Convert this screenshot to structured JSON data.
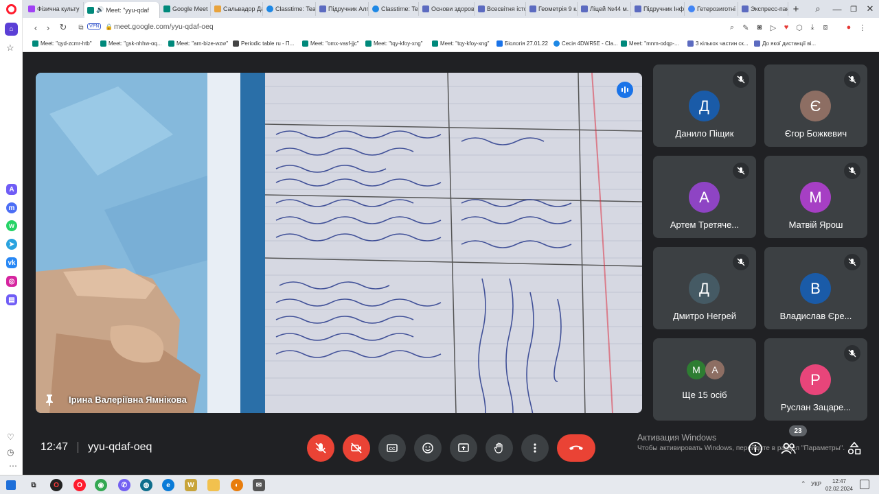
{
  "browser": {
    "tabs": [
      {
        "label": "Фізична культу",
        "color": "#a142f4"
      },
      {
        "label": "Meet: \"yyu-qdaf",
        "color": "#00897b",
        "active": true
      },
      {
        "label": "Google Meet",
        "color": "#00897b"
      },
      {
        "label": "Сальвадор Да",
        "color": "#e8a33d"
      },
      {
        "label": "Classtime: Teac",
        "color": "#1e88e5"
      },
      {
        "label": "Підручник Алг",
        "color": "#5c6bc0"
      },
      {
        "label": "Classtime: Teac",
        "color": "#1e88e5"
      },
      {
        "label": "Основи здоров",
        "color": "#5c6bc0"
      },
      {
        "label": "Всесвітня істор",
        "color": "#5c6bc0"
      },
      {
        "label": "Геометрія 9 кл",
        "color": "#5c6bc0"
      },
      {
        "label": "Ліцей №44 м.",
        "color": "#5c6bc0"
      },
      {
        "label": "Підручник Інф",
        "color": "#5c6bc0"
      },
      {
        "label": "Гетерозиготні",
        "color": "#4285f4"
      },
      {
        "label": "Экспресс-пане",
        "color": "#5c6bc0"
      }
    ],
    "url": "meet.google.com/yyu-qdaf-oeq",
    "vpn_label": "VPN",
    "bookmarks": [
      {
        "label": "Meet: \"qyd-zcmr-htb\"",
        "color": "#00897b"
      },
      {
        "label": "Meet: \"gsk-nhhw-oq...",
        "color": "#00897b"
      },
      {
        "label": "Meet: \"arn-bize-wzw\"",
        "color": "#00897b"
      },
      {
        "label": "Periodic table ru - П...",
        "color": "#444444"
      },
      {
        "label": "Meet: \"omx-vasf-jjc\"",
        "color": "#00897b"
      },
      {
        "label": "Meet: \"tqy-kfoy-xng\"",
        "color": "#00897b"
      },
      {
        "label": "Meet: \"tqy-kfoy-xng\"",
        "color": "#00897b"
      },
      {
        "label": "Біологія 27.01.22",
        "color": "#1a73e8"
      },
      {
        "label": "Сесія 4DWR5E - Cla...",
        "color": "#1e88e5"
      },
      {
        "label": "Meet: \"mnm-odqp-...",
        "color": "#00897b"
      },
      {
        "label": "3 кількох частин ск...",
        "color": "#5c6bc0"
      },
      {
        "label": "До якої дистанції ві...",
        "color": "#5c6bc0"
      }
    ]
  },
  "meet": {
    "main_speaker": "Ірина Валеріївна Ямнікова",
    "participants": [
      {
        "name": "Данило Піщик",
        "initial": "Д",
        "color": "#1a5ba8"
      },
      {
        "name": "Єгор Божкевич",
        "initial": "Є",
        "color": "#8d6e63"
      },
      {
        "name": "Артем Третяче...",
        "initial": "А",
        "color": "#8e44c4"
      },
      {
        "name": "Матвій Ярош",
        "initial": "М",
        "color": "#a63fc4"
      },
      {
        "name": "Дмитро Негрей",
        "initial": "Д",
        "color": "#455a64"
      },
      {
        "name": "Владислав Єре...",
        "initial": "В",
        "color": "#1a5ba8"
      },
      {
        "name": "Руслан Зацаре...",
        "initial": "Р",
        "color": "#e8457a"
      }
    ],
    "more_tile": {
      "label": "Ще 15 осіб",
      "avatars": [
        {
          "initial": "М",
          "color": "#2e7d32"
        },
        {
          "initial": "А",
          "color": "#8d6e63"
        }
      ]
    },
    "time": "12:47",
    "meeting_code": "yyu-qdaf-oeq",
    "people_count": "23",
    "activation_title": "Активация Windows",
    "activation_text": "Чтобы активировать Windows, перейдите в раздел \"Параметры\"."
  },
  "taskbar": {
    "lang": "УКР",
    "time": "12:47",
    "date": "02.02.2024"
  }
}
